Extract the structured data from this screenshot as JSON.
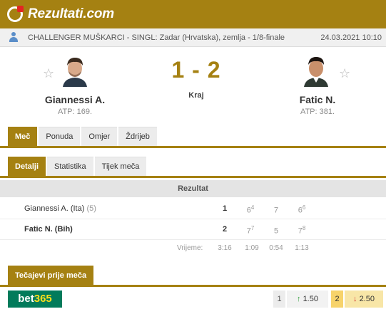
{
  "header": {
    "logo_text": "Rezultati.com"
  },
  "match_info": {
    "tournament": "CHALLENGER MUŠKARCI - SINGL: Zadar (Hrvatska), zemlja - 1/8-finale",
    "datetime": "24.03.2021 10:10"
  },
  "home": {
    "name": "Giannessi A.",
    "rank": "ATP: 169."
  },
  "away": {
    "name": "Fatic N.",
    "rank": "ATP: 381."
  },
  "score": {
    "display": "1 - 2",
    "status": "Kraj"
  },
  "main_tabs": [
    "Meč",
    "Ponuda",
    "Omjer",
    "Ždrijeb"
  ],
  "sub_tabs": [
    "Detalji",
    "Statistika",
    "Tijek meča"
  ],
  "results": {
    "header": "Rezultat",
    "rows": [
      {
        "name": "Giannessi A. (Ita)",
        "seed": "(5)",
        "sets": "1",
        "games": [
          {
            "g": "6",
            "tb": "4"
          },
          {
            "g": "7",
            "tb": ""
          },
          {
            "g": "6",
            "tb": "6"
          }
        ]
      },
      {
        "name": "Fatic N. (Bih)",
        "seed": "",
        "sets": "2",
        "games": [
          {
            "g": "7",
            "tb": "7"
          },
          {
            "g": "5",
            "tb": ""
          },
          {
            "g": "7",
            "tb": "8"
          }
        ]
      }
    ],
    "time_label": "Vrijeme:",
    "times": [
      "3:16",
      "1:09",
      "0:54",
      "1:13"
    ]
  },
  "odds_section": {
    "title": "Tečajevi prije meča",
    "bookmaker": {
      "name_a": "bet",
      "name_b": "365"
    },
    "odds": [
      {
        "label": "1",
        "value": "1.50",
        "trend": "up"
      },
      {
        "label": "2",
        "value": "2.50",
        "trend": "down"
      }
    ]
  },
  "colors": {
    "brand": "#a58112",
    "odds_up": "#2e9e3a",
    "odds_down": "#d0312d"
  }
}
